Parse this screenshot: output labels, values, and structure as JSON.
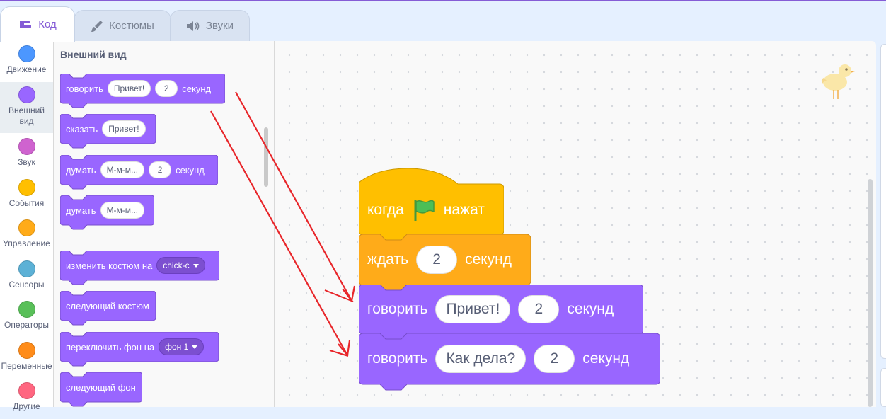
{
  "tabs": [
    {
      "label": "Код",
      "icon": "code-icon"
    },
    {
      "label": "Костюмы",
      "icon": "brush-icon"
    },
    {
      "label": "Звуки",
      "icon": "speaker-icon"
    }
  ],
  "categories": [
    {
      "label": "Движение",
      "color": "#4c97ff"
    },
    {
      "label": "Внешний\nвид",
      "color": "#9966ff"
    },
    {
      "label": "Звук",
      "color": "#cf63cf"
    },
    {
      "label": "События",
      "color": "#ffbf00"
    },
    {
      "label": "Управление",
      "color": "#ffab19"
    },
    {
      "label": "Сенсоры",
      "color": "#5cb1d6"
    },
    {
      "label": "Операторы",
      "color": "#59c059"
    },
    {
      "label": "Переменные",
      "color": "#ff8c1a"
    },
    {
      "label": "Другие",
      "color": "#ff6680"
    }
  ],
  "palette": {
    "title": "Внешний вид",
    "say_secs": {
      "say": "говорить",
      "text": "Привет!",
      "num": "2",
      "secs": "секунд"
    },
    "say": {
      "say": "сказать",
      "text": "Привет!"
    },
    "think_secs": {
      "think": "думать",
      "text": "М-м-м...",
      "num": "2",
      "secs": "секунд"
    },
    "think": {
      "think": "думать",
      "text": "М-м-м..."
    },
    "switch_costume": {
      "label": "изменить костюм на",
      "value": "chick-c"
    },
    "next_costume": {
      "label": "следующий костюм"
    },
    "switch_backdrop": {
      "label": "переключить фон на",
      "value": "фон 1"
    },
    "next_backdrop": {
      "label": "следующий фон"
    }
  },
  "script": {
    "hat": {
      "when": "когда",
      "clicked": "нажат"
    },
    "wait": {
      "label": "ждать",
      "num": "2",
      "secs": "секунд"
    },
    "say1": {
      "label": "говорить",
      "text": "Привет!",
      "num": "2",
      "secs": "секунд"
    },
    "say2": {
      "label": "говорить",
      "text": "Как дела?",
      "num": "2",
      "secs": "секунд"
    }
  },
  "colors": {
    "looks": "#9966ff",
    "events": "#ffbf00",
    "control": "#ffab19",
    "accent": "#855cd6",
    "arrow": "#e8262a"
  },
  "sprite_icon": "chick-icon"
}
